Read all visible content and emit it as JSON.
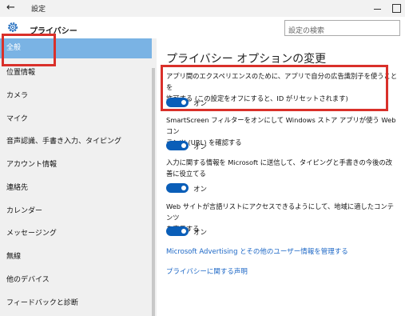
{
  "window": {
    "title": "設定"
  },
  "header": {
    "app_title": "プライバシー",
    "search_placeholder": "設定の検索"
  },
  "sidebar": {
    "items": [
      {
        "label": "全般"
      },
      {
        "label": "位置情報"
      },
      {
        "label": "カメラ"
      },
      {
        "label": "マイク"
      },
      {
        "label": "音声認識、手書き入力、タイピング"
      },
      {
        "label": "アカウント情報"
      },
      {
        "label": "連絡先"
      },
      {
        "label": "カレンダー"
      },
      {
        "label": "メッセージング"
      },
      {
        "label": "無線"
      },
      {
        "label": "他のデバイス"
      },
      {
        "label": "フィードバックと診断"
      }
    ]
  },
  "main": {
    "title": "プライバシー オプションの変更",
    "options": [
      {
        "desc1": "アプリ間のエクスペリエンスのために、アプリで自分の広告識別子を使うことを",
        "desc2": "許可する (この設定をオフにすると、ID がリセットされます)",
        "state": "オン"
      },
      {
        "desc1": "SmartScreen フィルターをオンにして Windows ストア アプリが使う Web コン",
        "desc2": "テンツ (URL) を確認する",
        "state": "オン"
      },
      {
        "desc1": "入力に関する情報を Microsoft に送信して、タイピングと手書きの今後の改",
        "desc2": "善に役立てる",
        "state": "オン"
      },
      {
        "desc1": "Web サイトが言語リストにアクセスできるようにして、地域に適したコンテンツ",
        "desc2": "を表示する",
        "state": "オン"
      }
    ],
    "links": [
      "Microsoft Advertising とその他のユーザー情報を管理する",
      "プライバシーに関する声明"
    ]
  },
  "colors": {
    "accent": "#0a5eb8",
    "link": "#1c67c6",
    "selected": "#7ab3e4",
    "annotation": "#d9302a"
  }
}
